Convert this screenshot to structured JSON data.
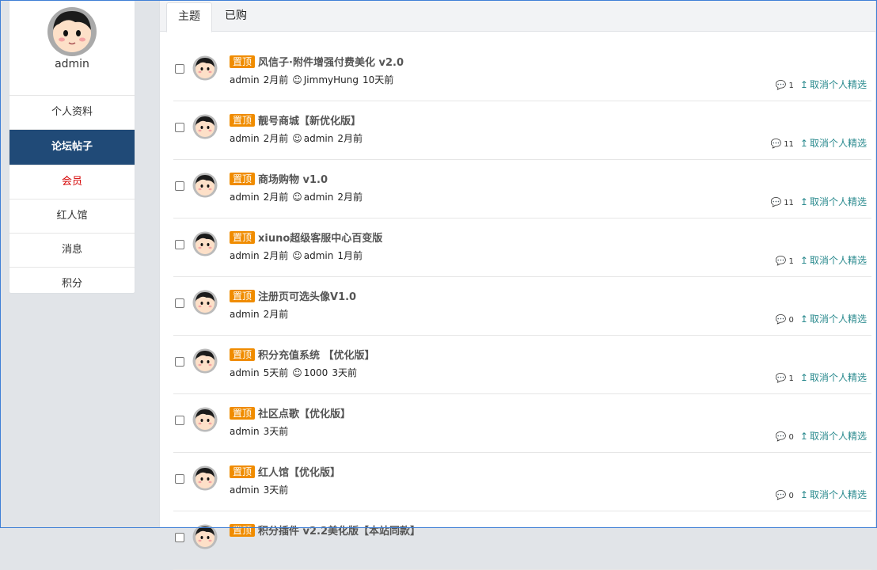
{
  "sidebar": {
    "username": "admin",
    "items": [
      {
        "label": "个人资料"
      },
      {
        "label": "论坛帖子"
      },
      {
        "label": "会员"
      },
      {
        "label": "红人馆"
      },
      {
        "label": "消息"
      },
      {
        "label": "积分"
      }
    ]
  },
  "tabs": [
    {
      "label": "主题"
    },
    {
      "label": "已购"
    }
  ],
  "pin_label": "置顶",
  "unfeature_label": "取消个人精选",
  "threads": [
    {
      "title": "风信子·附件增强付费美化 v2.0",
      "author": "admin",
      "posted": "2月前",
      "last_user": "JimmyHung",
      "last_time": "10天前",
      "comments": "1"
    },
    {
      "title": "靓号商城【新优化版】",
      "author": "admin",
      "posted": "2月前",
      "last_user": "admin",
      "last_time": "2月前",
      "comments": "11"
    },
    {
      "title": "商场购物 v1.0",
      "author": "admin",
      "posted": "2月前",
      "last_user": "admin",
      "last_time": "2月前",
      "comments": "11"
    },
    {
      "title": "xiuno超级客服中心百变版",
      "author": "admin",
      "posted": "2月前",
      "last_user": "admin",
      "last_time": "1月前",
      "comments": "1"
    },
    {
      "title": "注册页可选头像V1.0",
      "author": "admin",
      "posted": "2月前",
      "last_user": "",
      "last_time": "",
      "comments": "0"
    },
    {
      "title": "积分充值系统 【优化版】",
      "author": "admin",
      "posted": "5天前",
      "last_user": "1000",
      "last_time": "3天前",
      "comments": "1"
    },
    {
      "title": "社区点歌【优化版】",
      "author": "admin",
      "posted": "3天前",
      "last_user": "",
      "last_time": "",
      "comments": "0"
    },
    {
      "title": "红人馆【优化版】",
      "author": "admin",
      "posted": "3天前",
      "last_user": "",
      "last_time": "",
      "comments": "0"
    },
    {
      "title": "积分插件 v2.2美化版【本站同款】",
      "author": "",
      "posted": "",
      "last_user": "",
      "last_time": "",
      "comments": ""
    }
  ]
}
